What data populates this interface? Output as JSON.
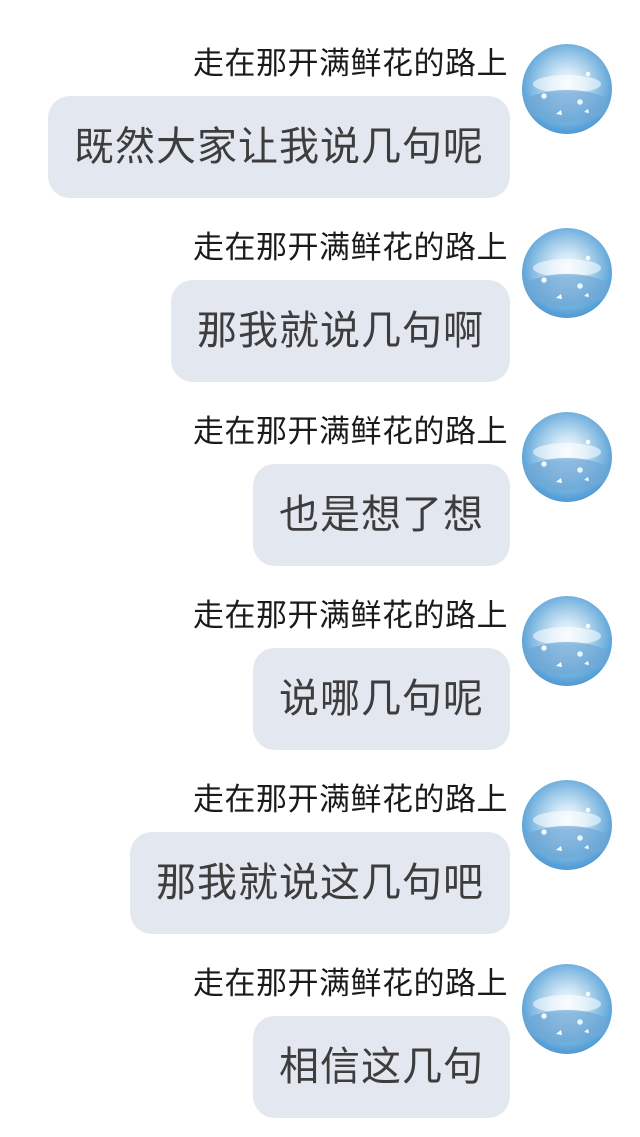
{
  "sender_name": "走在那开满鲜花的路上",
  "messages": [
    {
      "text": "既然大家让我说几句呢"
    },
    {
      "text": "那我就说几句啊"
    },
    {
      "text": "也是想了想"
    },
    {
      "text": "说哪几句呢"
    },
    {
      "text": "那我就说这几句吧"
    },
    {
      "text": "相信这几句"
    }
  ],
  "colors": {
    "bubble": "#e3e7ef",
    "bubble_text": "#3d3d3d",
    "sender_text": "#1b1b1b",
    "background": "#ffffff"
  },
  "avatar_icon": "sky-butterfly-avatar-icon"
}
